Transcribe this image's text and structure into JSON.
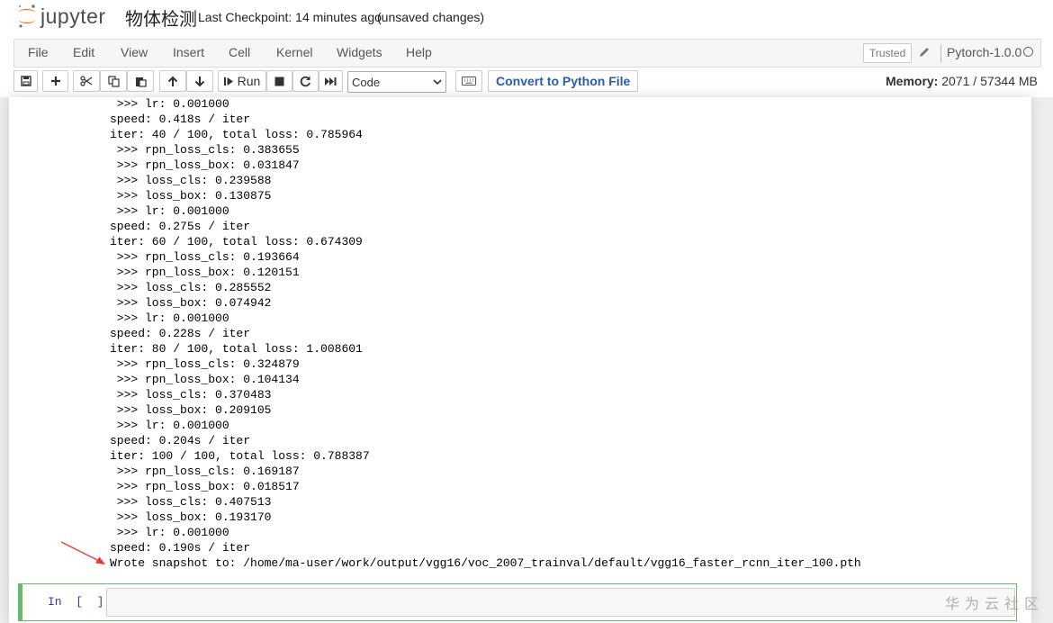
{
  "header": {
    "logo_text": "jupyter",
    "notebook_title": "物体检测",
    "checkpoint": "Last Checkpoint: 14 minutes ago",
    "unsaved": "(unsaved changes)"
  },
  "menu": {
    "items": [
      "File",
      "Edit",
      "View",
      "Insert",
      "Cell",
      "Kernel",
      "Widgets",
      "Help"
    ],
    "trusted": "Trusted",
    "kernel_name": "Pytorch-1.0.0"
  },
  "toolbar": {
    "buttons": [
      "save-icon",
      "plus-icon",
      "scissors-icon",
      "copy-icon",
      "paste-icon",
      "arrow-up-icon",
      "arrow-down-icon",
      "run-icon",
      "stop-icon",
      "restart-icon",
      "fast-forward-icon",
      "keyboard-icon"
    ],
    "run_label": "Run",
    "cell_type": "Code",
    "convert_label": "Convert to Python File",
    "memory_label": "Memory:",
    "memory_value": "2071 / 57344 MB"
  },
  "output_lines": [
    " >>> lr: 0.001000",
    "speed: 0.418s / iter",
    "iter: 40 / 100, total loss: 0.785964",
    " >>> rpn_loss_cls: 0.383655",
    " >>> rpn_loss_box: 0.031847",
    " >>> loss_cls: 0.239588",
    " >>> loss_box: 0.130875",
    " >>> lr: 0.001000",
    "speed: 0.275s / iter",
    "iter: 60 / 100, total loss: 0.674309",
    " >>> rpn_loss_cls: 0.193664",
    " >>> rpn_loss_box: 0.120151",
    " >>> loss_cls: 0.285552",
    " >>> loss_box: 0.074942",
    " >>> lr: 0.001000",
    "speed: 0.228s / iter",
    "iter: 80 / 100, total loss: 1.008601",
    " >>> rpn_loss_cls: 0.324879",
    " >>> rpn_loss_box: 0.104134",
    " >>> loss_cls: 0.370483",
    " >>> loss_box: 0.209105",
    " >>> lr: 0.001000",
    "speed: 0.204s / iter",
    "iter: 100 / 100, total loss: 0.788387",
    " >>> rpn_loss_cls: 0.169187",
    " >>> rpn_loss_box: 0.018517",
    " >>> loss_cls: 0.407513",
    " >>> loss_box: 0.193170",
    " >>> lr: 0.001000",
    "speed: 0.190s / iter",
    "Wrote snapshot to: /home/ma-user/work/output/vgg16/voc_2007_trainval/default/vgg16_faster_rcnn_iter_100.pth"
  ],
  "input_cell": {
    "prompt": "In  [  ]:"
  },
  "watermark": "华为云社区",
  "colors": {
    "annotation_arrow": "#e53935",
    "selected_cell_border": "#66bb6a",
    "convert_button_text": "#2a5db0"
  }
}
